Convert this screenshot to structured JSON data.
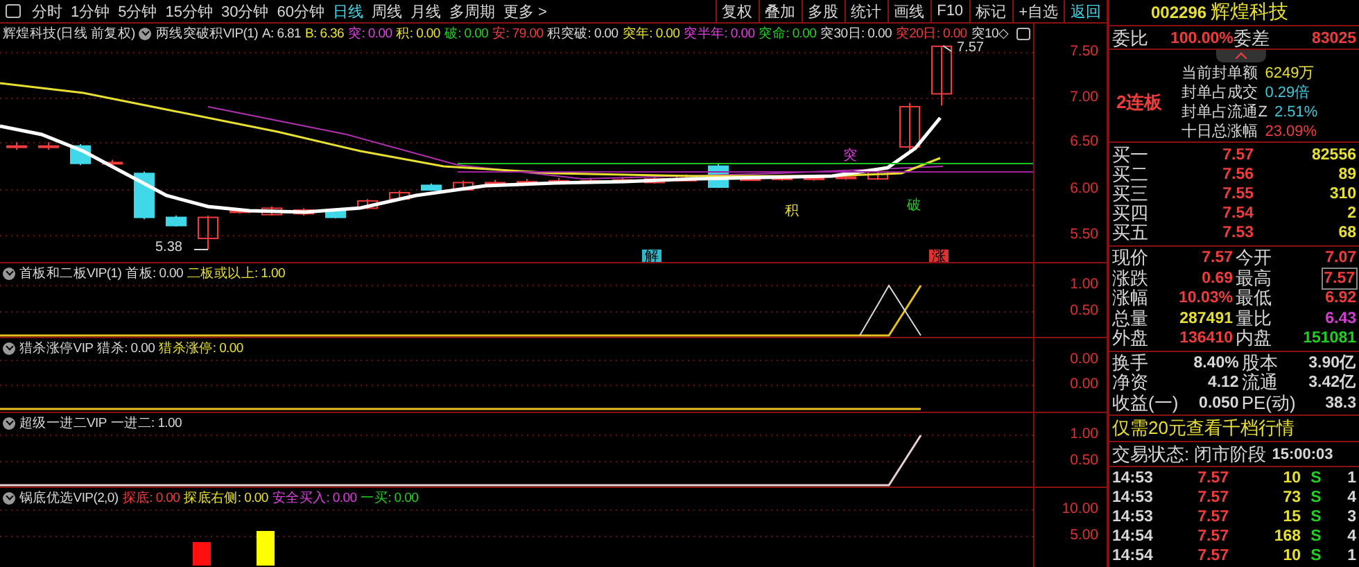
{
  "toolbar": {
    "periods": [
      {
        "label": "分时",
        "selected": false
      },
      {
        "label": "1分钟",
        "selected": false
      },
      {
        "label": "5分钟",
        "selected": false
      },
      {
        "label": "15分钟",
        "selected": false
      },
      {
        "label": "30分钟",
        "selected": false
      },
      {
        "label": "60分钟",
        "selected": false
      },
      {
        "label": "日线",
        "selected": true
      },
      {
        "label": "周线",
        "selected": false
      },
      {
        "label": "月线",
        "selected": false
      },
      {
        "label": "多周期",
        "selected": false
      },
      {
        "label": "更多 >",
        "selected": false
      }
    ],
    "buttons": [
      {
        "label": "复权",
        "selected": false
      },
      {
        "label": "叠加",
        "selected": false
      },
      {
        "label": "多股",
        "selected": false
      },
      {
        "label": "统计",
        "selected": false
      },
      {
        "label": "画线",
        "selected": false
      },
      {
        "label": "F10",
        "selected": false
      },
      {
        "label": "标记",
        "selected": false
      },
      {
        "label": "+自选",
        "selected": false
      },
      {
        "label": "返回",
        "selected": true
      }
    ]
  },
  "main_chart": {
    "stock_label": "辉煌科技(日线 前复权)",
    "indicator": "两线突破积VIP(1)",
    "values": [
      {
        "text": "A: 6.81",
        "color": "#d8d8d8"
      },
      {
        "text": "B: 6.36",
        "color": "#e8e030"
      },
      {
        "text": "突: 0.00",
        "color": "#e040e0"
      },
      {
        "text": "积: 0.00",
        "color": "#e8e030"
      },
      {
        "text": "破: 0.00",
        "color": "#20d020"
      },
      {
        "text": "安: 79.00",
        "color": "#f03c3c"
      },
      {
        "text": "积突破: 0.00",
        "color": "#d8d8d8"
      },
      {
        "text": "突年: 0.00",
        "color": "#e8e030"
      },
      {
        "text": "突半年: 0.00",
        "color": "#e040e0"
      },
      {
        "text": "突命: 0.00",
        "color": "#20d020"
      },
      {
        "text": "突30日: 0.00",
        "color": "#d8d8d8"
      },
      {
        "text": "突20日: 0.00",
        "color": "#f03c3c"
      },
      {
        "text": "突10◇",
        "color": "#d8d8d8"
      }
    ],
    "axis_ticks": [
      "7.50",
      "7.00",
      "6.50",
      "6.00",
      "5.50"
    ],
    "high_label": "7.57",
    "low_label": "5.38",
    "signals": [
      {
        "text": "突",
        "color": "#e040e0"
      },
      {
        "text": "积",
        "color": "#e8e030"
      },
      {
        "text": "破",
        "color": "#20d020"
      },
      {
        "text": "解",
        "color": "#30b8c8"
      },
      {
        "text": "涨",
        "color": "#e03030"
      }
    ]
  },
  "panels": [
    {
      "title": "首板和二板VIP(1)",
      "values": [
        {
          "text": "首板: 0.00",
          "color": "#d8d8d8"
        },
        {
          "text": "二板或以上: 1.00",
          "color": "#e8e030"
        }
      ],
      "axis_ticks": [
        "1.00",
        "0.50"
      ]
    },
    {
      "title": "猎杀涨停VIP",
      "values": [
        {
          "text": "猎杀: 0.00",
          "color": "#d8d8d8"
        },
        {
          "text": "猎杀涨停: 0.00",
          "color": "#e8e030"
        }
      ],
      "axis_ticks": [
        "0.00",
        "0.00"
      ]
    },
    {
      "title": "超级一进二VIP",
      "values": [
        {
          "text": "一进二: 1.00",
          "color": "#d8d8d8"
        }
      ],
      "axis_ticks": [
        "1.00",
        "0.50"
      ]
    },
    {
      "title": "锅底优选VIP(2,0)",
      "values": [
        {
          "text": "探底: 0.00",
          "color": "#f03c3c"
        },
        {
          "text": "探底右侧: 0.00",
          "color": "#e8e030"
        },
        {
          "text": "安全买入: 0.00",
          "color": "#e040e0"
        },
        {
          "text": "一买: 0.00",
          "color": "#20d020"
        }
      ],
      "axis_ticks": [
        "10.00",
        "5.00"
      ]
    }
  ],
  "quote_panel": {
    "code": "002296",
    "name": "辉煌科技",
    "order_ratio": [
      {
        "label": "委比",
        "value": "100.00%"
      },
      {
        "label": "委差",
        "value": "83025"
      }
    ],
    "limit_streak": "2连板",
    "seal_info": [
      {
        "label": "当前封单额",
        "value": "6249万",
        "color": "#e8e030"
      },
      {
        "label": "封单占成交",
        "value": "0.29倍",
        "color": "#40c8d8"
      },
      {
        "label": "封单占流通Z",
        "value": "2.51%",
        "color": "#40c8d8"
      },
      {
        "label": "十日总涨幅",
        "value": "23.09%",
        "color": "#f03c3c"
      }
    ],
    "bids": [
      {
        "label": "买一",
        "price": "7.57",
        "volume": "82556"
      },
      {
        "label": "买二",
        "price": "7.56",
        "volume": "89"
      },
      {
        "label": "买三",
        "price": "7.55",
        "volume": "310"
      },
      {
        "label": "买四",
        "price": "7.54",
        "volume": "2"
      },
      {
        "label": "买五",
        "price": "7.53",
        "volume": "68"
      }
    ],
    "stats": [
      {
        "label": "现价",
        "value": "7.57",
        "color": "#f03c3c",
        "boxed": false
      },
      {
        "label": "今开",
        "value": "7.07",
        "color": "#f03c3c",
        "boxed": false
      },
      {
        "label": "涨跌",
        "value": "0.69",
        "color": "#f03c3c",
        "boxed": false
      },
      {
        "label": "最高",
        "value": "7.57",
        "color": "#f03c3c",
        "boxed": true
      },
      {
        "label": "涨幅",
        "value": "10.03%",
        "color": "#f03c3c",
        "boxed": false
      },
      {
        "label": "最低",
        "value": "6.92",
        "color": "#f03c3c",
        "boxed": false
      },
      {
        "label": "总量",
        "value": "287491",
        "color": "#e8e030",
        "boxed": false
      },
      {
        "label": "量比",
        "value": "6.43",
        "color": "#d040d0",
        "boxed": false
      },
      {
        "label": "外盘",
        "value": "136410",
        "color": "#f03c3c",
        "boxed": false
      },
      {
        "label": "内盘",
        "value": "151081",
        "color": "#20d020",
        "boxed": false
      }
    ],
    "fundamentals": [
      {
        "label": "换手",
        "value": "8.40%"
      },
      {
        "label": "股本",
        "value": "3.90亿"
      },
      {
        "label": "净资",
        "value": "4.12"
      },
      {
        "label": "流通",
        "value": "3.42亿"
      },
      {
        "label": "收益(一)",
        "value": "0.050"
      },
      {
        "label": "PE(动)",
        "value": "38.3"
      }
    ],
    "promo": "仅需20元查看千档行情",
    "status_label": "交易状态: 闭市阶段",
    "status_time": "15:00:03",
    "trades": [
      {
        "time": "14:53",
        "price": "7.57",
        "volume": "10",
        "side": "S",
        "count": "1"
      },
      {
        "time": "14:53",
        "price": "7.57",
        "volume": "73",
        "side": "S",
        "count": "4"
      },
      {
        "time": "14:53",
        "price": "7.57",
        "volume": "15",
        "side": "S",
        "count": "3"
      },
      {
        "time": "14:54",
        "price": "7.57",
        "volume": "168",
        "side": "S",
        "count": "4"
      },
      {
        "time": "14:54",
        "price": "7.57",
        "volume": "10",
        "side": "S",
        "count": "1"
      }
    ]
  }
}
